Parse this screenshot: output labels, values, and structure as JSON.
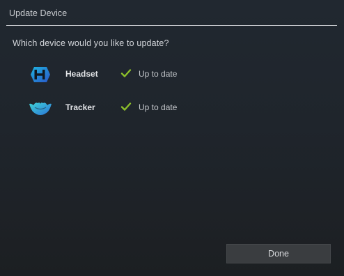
{
  "window": {
    "title": "Update Device"
  },
  "prompt": "Which device would you like to update?",
  "devices": [
    {
      "name": "Headset",
      "status": "Up to date",
      "icon": "headset-hex-icon",
      "status_icon": "check-icon"
    },
    {
      "name": "Tracker",
      "status": "Up to date",
      "icon": "tracker-icon",
      "status_icon": "check-icon"
    }
  ],
  "actions": {
    "done_label": "Done"
  },
  "colors": {
    "check": "#8cbf2a",
    "headset_icon_gradient": [
      "#1fb5e0",
      "#2a57c9"
    ],
    "tracker_icon_gradient": [
      "#3fd3d6",
      "#2a74d8"
    ],
    "button_bg": "#3a3d40"
  }
}
